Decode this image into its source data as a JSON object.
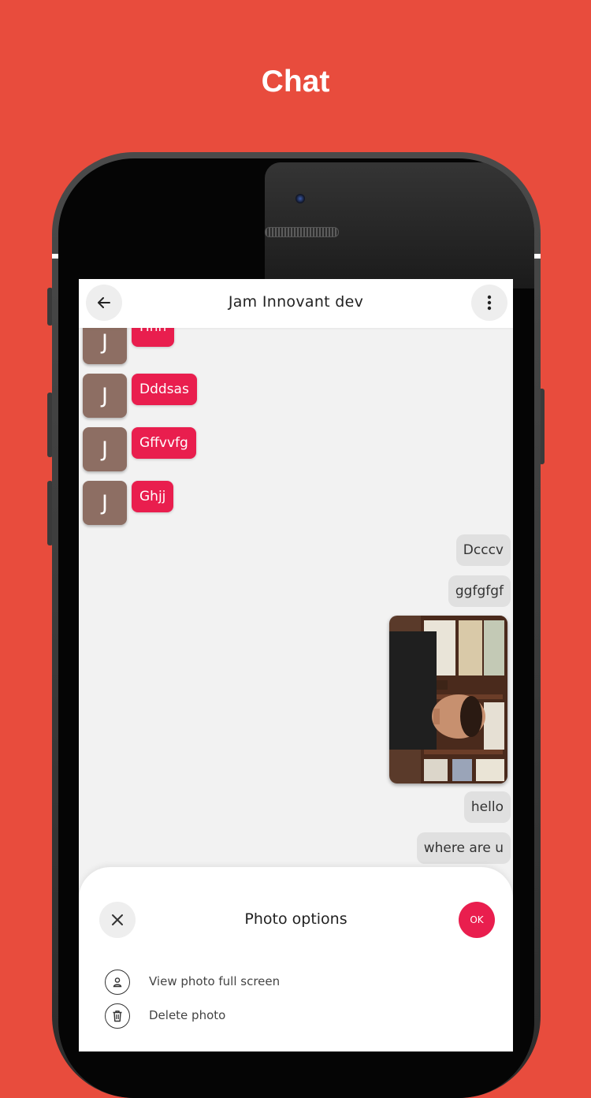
{
  "promo": {
    "title": "Chat"
  },
  "chat": {
    "title": "Jam Innovant dev",
    "avatar_initial": "J",
    "incoming": [
      {
        "text": "Hhh"
      },
      {
        "text": "Dddsas"
      },
      {
        "text": "Gffvvfg"
      },
      {
        "text": "Ghjj"
      }
    ],
    "outgoing_top": [
      {
        "text": "Dcccv"
      },
      {
        "text": "ggfgfgf"
      }
    ],
    "outgoing_bottom": [
      {
        "text": "hello"
      },
      {
        "text": "where are u"
      }
    ]
  },
  "sheet": {
    "title": "Photo options",
    "ok_label": "OK",
    "options": [
      {
        "label": "View photo full screen",
        "icon": "person-icon"
      },
      {
        "label": "Delete photo",
        "icon": "trash-icon"
      }
    ]
  },
  "colors": {
    "background": "#e84c3d",
    "accent": "#e91e4e",
    "avatar": "#8d6e63",
    "outgoing_bubble": "#e0e0e0"
  }
}
